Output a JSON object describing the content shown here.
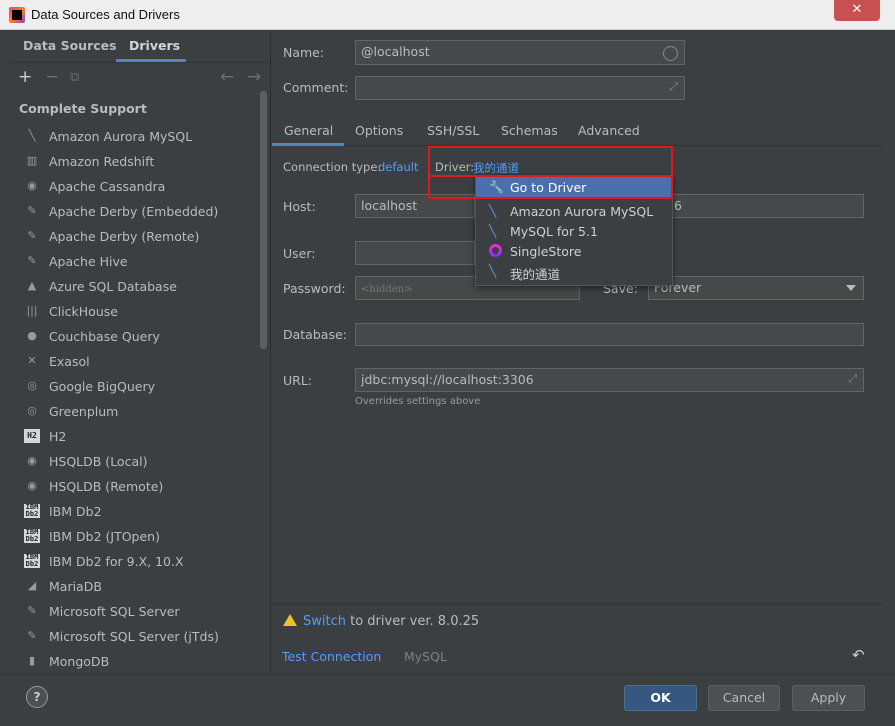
{
  "window": {
    "title": "Data Sources and Drivers",
    "close_glyph": "✕"
  },
  "sidebar": {
    "tabs": [
      "Data Sources",
      "Drivers"
    ],
    "toolbar": {
      "add": "+",
      "remove": "−",
      "copy": "⧉",
      "back": "←",
      "forward": "→"
    },
    "section_header": "Complete Support",
    "items": [
      {
        "label": "Amazon Aurora MySQL",
        "icon": "╲"
      },
      {
        "label": "Amazon Redshift",
        "icon": "▥"
      },
      {
        "label": "Apache Cassandra",
        "icon": "◉"
      },
      {
        "label": "Apache Derby (Embedded)",
        "icon": "✎"
      },
      {
        "label": "Apache Derby (Remote)",
        "icon": "✎"
      },
      {
        "label": "Apache Hive",
        "icon": "✎"
      },
      {
        "label": "Azure SQL Database",
        "icon": "▲"
      },
      {
        "label": "ClickHouse",
        "icon": "|||"
      },
      {
        "label": "Couchbase Query",
        "icon": "●"
      },
      {
        "label": "Exasol",
        "icon": "✕"
      },
      {
        "label": "Google BigQuery",
        "icon": "◎"
      },
      {
        "label": "Greenplum",
        "icon": "◎"
      },
      {
        "label": "H2",
        "icon": "H2"
      },
      {
        "label": "HSQLDB (Local)",
        "icon": "◉"
      },
      {
        "label": "HSQLDB (Remote)",
        "icon": "◉"
      },
      {
        "label": "IBM Db2",
        "icon": "IBM Db2"
      },
      {
        "label": "IBM Db2 (JTOpen)",
        "icon": "IBM Db2"
      },
      {
        "label": "IBM Db2 for 9.X, 10.X",
        "icon": "IBM Db2"
      },
      {
        "label": "MariaDB",
        "icon": "◢"
      },
      {
        "label": "Microsoft SQL Server",
        "icon": "✎"
      },
      {
        "label": "Microsoft SQL Server (jTds)",
        "icon": "✎"
      },
      {
        "label": "MongoDB",
        "icon": "▮"
      }
    ]
  },
  "form": {
    "name_label": "Name:",
    "name_value": "@localhost",
    "comment_label": "Comment:",
    "comment_value": "",
    "tabs": [
      "General",
      "Options",
      "SSH/SSL",
      "Schemas",
      "Advanced"
    ],
    "connection_type_label": "Connection type:",
    "connection_type_value": "default",
    "driver_label": "Driver:",
    "driver_value": "我的通道",
    "host_label": "Host:",
    "host_value": "localhost",
    "port_tail": "6",
    "user_label": "User:",
    "password_label": "Password:",
    "password_placeholder": "<hidden>",
    "save_label": "Save:",
    "save_value": "Forever",
    "database_label": "Database:",
    "url_label": "URL:",
    "url_value": "jdbc:mysql://localhost:3306",
    "url_hint": "Overrides settings above"
  },
  "driver_popup": {
    "items": [
      {
        "label": "Go to Driver",
        "icon": "wrench-icon",
        "glyph": "🔧"
      },
      {
        "label": "Amazon Aurora MySQL",
        "icon": "mysql-dolphin-icon",
        "glyph": "╲"
      },
      {
        "label": "MySQL for 5.1",
        "icon": "mysql-dolphin-icon",
        "glyph": "╲"
      },
      {
        "label": "SingleStore",
        "icon": "singlestore-icon",
        "glyph": ""
      },
      {
        "label": "我的通道",
        "icon": "mysql-dolphin-icon",
        "glyph": "╲"
      }
    ],
    "highlight_color": "#e0191c",
    "selected_color": "#4b6eaf"
  },
  "footer": {
    "switch_link": "Switch",
    "switch_rest": " to driver ver. 8.0.25",
    "test_connection": "Test Connection",
    "driver_name": "MySQL",
    "revert_glyph": "↶"
  },
  "buttons": {
    "help": "?",
    "ok": "OK",
    "cancel": "Cancel",
    "apply": "Apply"
  }
}
